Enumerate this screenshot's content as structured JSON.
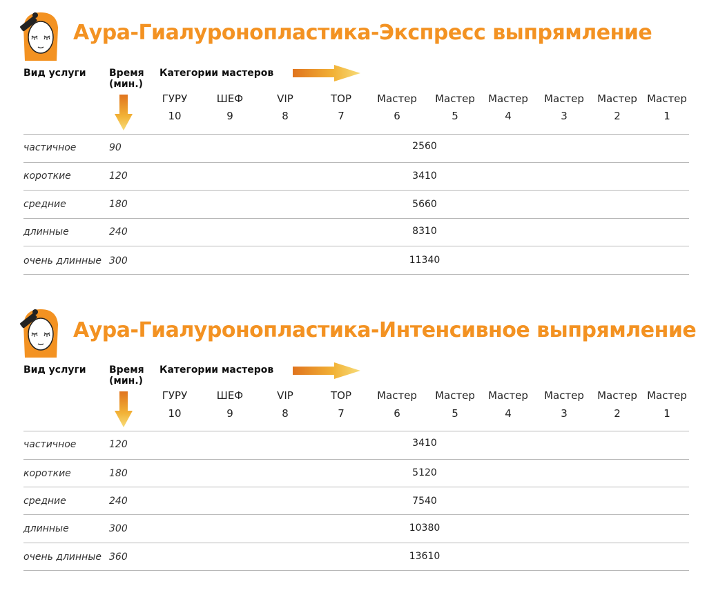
{
  "sections": [
    {
      "title": "Аура-Гиалуронопластика-Экспресс выпрямление",
      "headers": {
        "service": "Вид услуги",
        "time": "Время (мин.)",
        "categories": "Категории мастеров"
      },
      "categories": [
        {
          "name": "ГУРУ",
          "level": "10"
        },
        {
          "name": "ШЕФ",
          "level": "9"
        },
        {
          "name": "VIP",
          "level": "8"
        },
        {
          "name": "TOP",
          "level": "7"
        },
        {
          "name": "Мастер",
          "level": "6"
        },
        {
          "name": "Мастер",
          "level": "5"
        },
        {
          "name": "Мастер",
          "level": "4"
        },
        {
          "name": "Мастер",
          "level": "3"
        },
        {
          "name": "Мастер",
          "level": "2"
        },
        {
          "name": "Мастер",
          "level": "1"
        }
      ],
      "rows": [
        {
          "service": "частичное",
          "time": "90",
          "price": "2560"
        },
        {
          "service": "короткие",
          "time": "120",
          "price": "3410"
        },
        {
          "service": "средние",
          "time": "180",
          "price": "5660"
        },
        {
          "service": "длинные",
          "time": "240",
          "price": "8310"
        },
        {
          "service": "очень длинные",
          "time": "300",
          "price": "11340"
        }
      ]
    },
    {
      "title": "Аура-Гиалуронопластика-Интенсивное выпрямление",
      "headers": {
        "service": "Вид услуги",
        "time": "Время (мин.)",
        "categories": "Категории мастеров"
      },
      "categories": [
        {
          "name": "ГУРУ",
          "level": "10"
        },
        {
          "name": "ШЕФ",
          "level": "9"
        },
        {
          "name": "VIP",
          "level": "8"
        },
        {
          "name": "TOP",
          "level": "7"
        },
        {
          "name": "Мастер",
          "level": "6"
        },
        {
          "name": "Мастер",
          "level": "5"
        },
        {
          "name": "Мастер",
          "level": "4"
        },
        {
          "name": "Мастер",
          "level": "3"
        },
        {
          "name": "Мастер",
          "level": "2"
        },
        {
          "name": "Мастер",
          "level": "1"
        }
      ],
      "rows": [
        {
          "service": "частичное",
          "time": "120",
          "price": "3410"
        },
        {
          "service": "короткие",
          "time": "180",
          "price": "5120"
        },
        {
          "service": "средние",
          "time": "240",
          "price": "7540"
        },
        {
          "service": "длинные",
          "time": "300",
          "price": "10380"
        },
        {
          "service": "очень длинные",
          "time": "360",
          "price": "13610"
        }
      ]
    }
  ],
  "colors": {
    "accent": "#f39222",
    "gold": "#f2c04a",
    "divider": "#b8b8b8"
  },
  "icons": {
    "logo": "woman-face-with-brush-icon",
    "arrow_right": "gradient-arrow-right-icon",
    "arrow_down": "gradient-arrow-down-icon"
  }
}
